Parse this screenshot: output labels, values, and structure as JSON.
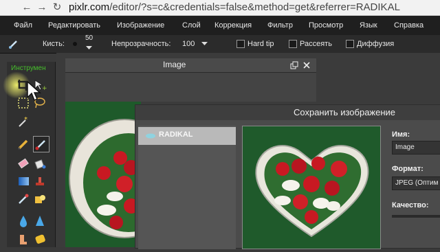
{
  "browser": {
    "url_domain": "pixlr.com",
    "url_path": "/editor/?s=c&credentials=false&method=get&referrer=RADIKAL"
  },
  "menu": [
    "Файл",
    "Редактировать",
    "Изображение",
    "Слой",
    "Коррекция",
    "Фильтр",
    "Просмотр",
    "Язык",
    "Справка"
  ],
  "options": {
    "brush_label": "Кисть:",
    "brush_size": "50",
    "opacity_label": "Непрозрачность:",
    "opacity_value": "100",
    "hard_tip": "Hard tip",
    "scatter": "Рассеять",
    "diffusion": "Диффузия"
  },
  "toolbox": {
    "title": "Инструмен"
  },
  "image_window": {
    "title": "Image"
  },
  "save_dialog": {
    "title": "Сохранить изображение",
    "service": "RADIKAL",
    "name_label": "Имя:",
    "name_value": "Image",
    "format_label": "Формат:",
    "format_value": "JPEG (Оптим",
    "quality_label": "Качество:"
  },
  "colors": {
    "accent_green": "#3fae2a",
    "canvas_green": "#1e5a2a",
    "rose_red": "#c81922"
  }
}
